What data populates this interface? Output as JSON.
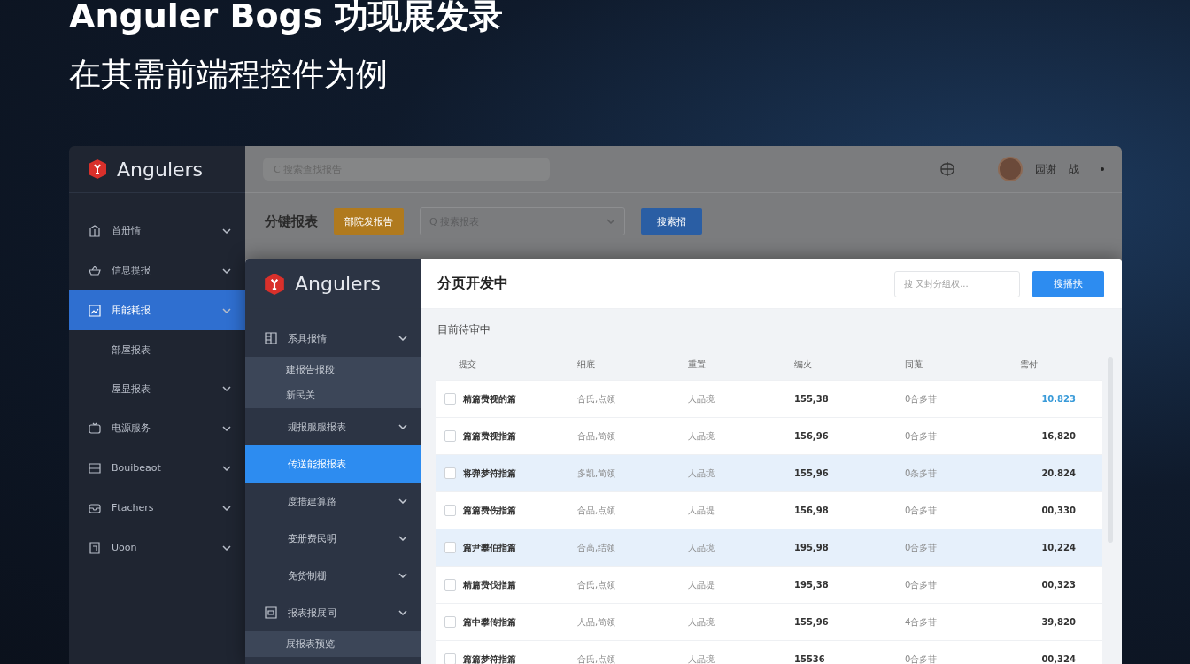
{
  "headline": {
    "title": "Anguler Bogs 功现展发录",
    "subtitle": "在其需前端程控件为例"
  },
  "back_window": {
    "logo": "Angulers",
    "search": {
      "placeholder": "C 搜索查找报告"
    },
    "user": {
      "name": "园谢",
      "role": "战"
    },
    "sidebar": {
      "items": [
        {
          "label": "首册情",
          "kind": "icon",
          "expandable": true,
          "selected": false,
          "expanded": false
        },
        {
          "label": "信息提报",
          "kind": "icon",
          "expandable": true,
          "selected": false,
          "expanded": false
        },
        {
          "label": "用能耗报",
          "kind": "icon",
          "expandable": true,
          "selected": true,
          "expanded": true,
          "children": [
            {
              "label": "部屋报表",
              "expandable": false,
              "selected": false
            },
            {
              "label": "屋显报表",
              "expandable": true,
              "selected": false
            }
          ]
        },
        {
          "label": "电源服务",
          "kind": "icon",
          "expandable": true,
          "selected": false,
          "expanded": false
        },
        {
          "label": "Bouibeaot",
          "kind": "icon",
          "expandable": true,
          "selected": false,
          "expanded": false
        },
        {
          "label": "Ftachers",
          "kind": "icon",
          "expandable": true,
          "selected": false,
          "expanded": false
        },
        {
          "label": "Uoon",
          "kind": "icon",
          "expandable": true,
          "selected": false,
          "expanded": false
        }
      ]
    },
    "toolbar": {
      "title": "分键报表",
      "primary_button": "部院发报告",
      "select": {
        "placeholder": "Q 搜索报表"
      },
      "search_button": "搜索招"
    }
  },
  "front_window": {
    "logo": "Angulers",
    "header": {
      "title": "分页开发中",
      "search": {
        "placeholder": "搜 又封分组权..."
      },
      "button": "搜播扶"
    },
    "sidebar": {
      "items": [
        {
          "label": "系具报情",
          "kind": "icon",
          "expandable": true,
          "selected": false,
          "expanded": true,
          "children": [
            {
              "label": "建报告报段",
              "expandable": false,
              "selected": false
            },
            {
              "label": "新民关",
              "expandable": false,
              "selected": false
            }
          ]
        },
        {
          "label": "规报服服报表",
          "kind": "text",
          "expandable": true,
          "selected": false,
          "expanded": false
        },
        {
          "label": "传送能报报表",
          "kind": "text",
          "expandable": false,
          "selected": true,
          "expanded": false
        },
        {
          "label": "度措建算路",
          "kind": "text",
          "expandable": true,
          "selected": false,
          "expanded": false
        },
        {
          "label": "变册费民明",
          "kind": "text",
          "expandable": true,
          "selected": false,
          "expanded": false
        },
        {
          "label": "免货制栅",
          "kind": "text",
          "expandable": true,
          "selected": false,
          "expanded": false
        },
        {
          "label": "报表报展同",
          "kind": "icon",
          "expandable": true,
          "selected": false,
          "expanded": true,
          "children": [
            {
              "label": "展报表预览",
              "expandable": false,
              "selected": false
            }
          ]
        }
      ]
    },
    "section": "目前待审中",
    "table": {
      "columns": [
        "提交",
        "细底",
        "重置",
        "编火",
        "同蒐",
        "需付"
      ],
      "rows": [
        {
          "selected": false,
          "checked": false,
          "link": true,
          "cells": [
            "精篇费视的篇",
            "合氏,点领",
            "人品境",
            "155,38",
            "0合多苷",
            "10.823"
          ]
        },
        {
          "selected": false,
          "checked": false,
          "link": false,
          "cells": [
            "篇篇费视指篇",
            "合品,简领",
            "人品境",
            "156,96",
            "0合多苷",
            "16,820"
          ]
        },
        {
          "selected": true,
          "checked": false,
          "link": false,
          "cells": [
            "将弹梦符指篇",
            "多凯,简领",
            "人品境",
            "155,96",
            "0条多苷",
            "20.824"
          ]
        },
        {
          "selected": false,
          "checked": false,
          "link": false,
          "cells": [
            "篇篇费伤指篇",
            "合品,点领",
            "人品堤",
            "156,98",
            "0合多苷",
            "00,330"
          ]
        },
        {
          "selected": true,
          "checked": false,
          "link": false,
          "cells": [
            "篇尹攀伯指篇",
            "合高,结领",
            "人品境",
            "195,98",
            "0合多苷",
            "10,224"
          ]
        },
        {
          "selected": false,
          "checked": false,
          "link": false,
          "cells": [
            "精篇费伐指篇",
            "合氏,点领",
            "人品堤",
            "195,38",
            "0合多苷",
            "00,323"
          ]
        },
        {
          "selected": false,
          "checked": false,
          "link": false,
          "cells": [
            "篇中攀传指篇",
            "人品,简领",
            "人品境",
            "155,96",
            "4合多苷",
            "39,820"
          ]
        },
        {
          "selected": false,
          "checked": false,
          "link": false,
          "cells": [
            "篇篇梦符指篇",
            "合氏,点领",
            "人品境",
            "15536",
            "0合多苷",
            "00,324"
          ]
        }
      ]
    }
  }
}
